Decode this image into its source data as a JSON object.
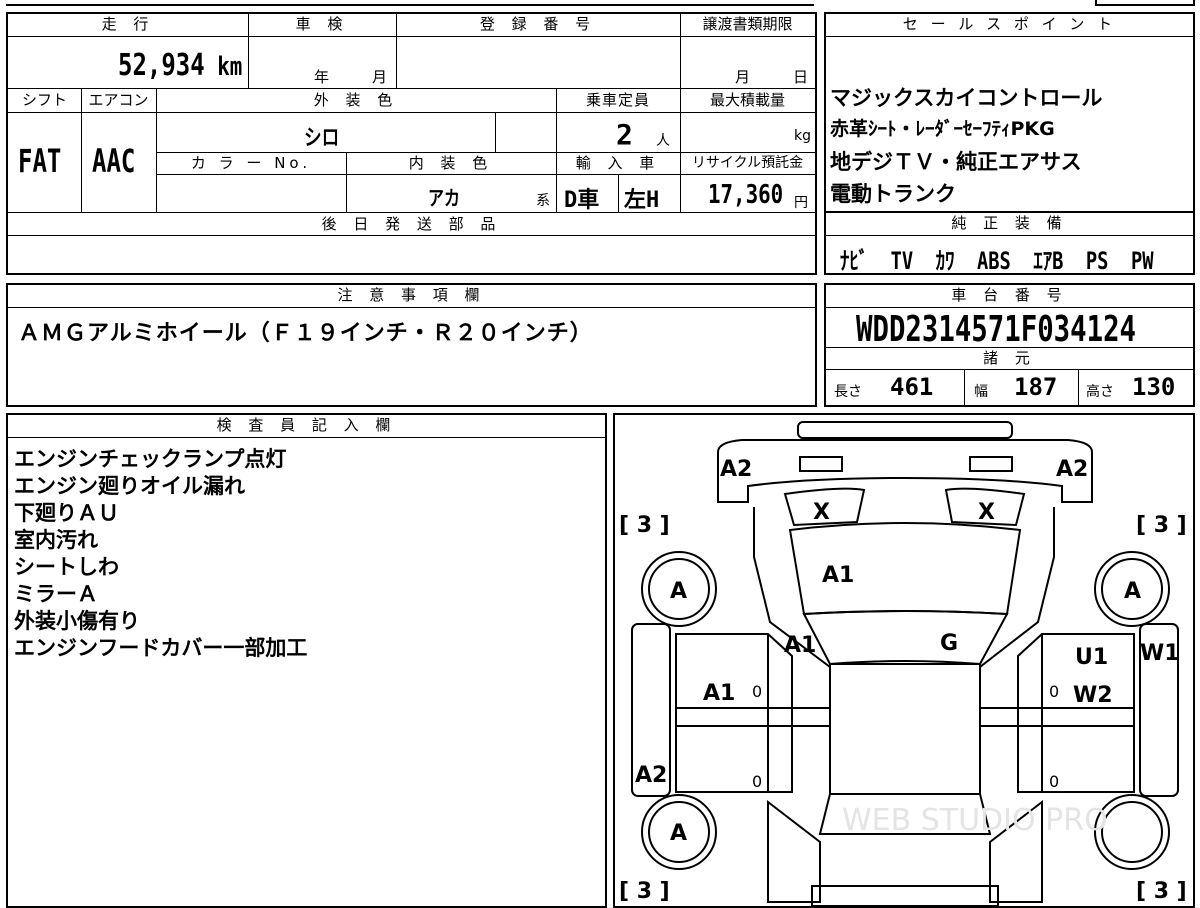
{
  "top": {
    "mileage_header": "走 行",
    "mileage_value": "52,934",
    "mileage_unit": "km",
    "shaken_header": "車 検",
    "shaken_year": "年",
    "shaken_month": "月",
    "registration_header": "登 録 番 号",
    "transfer_header": "譲渡書類期限",
    "transfer_month": "月",
    "transfer_day": "日"
  },
  "row2": {
    "shift_header": "シフト",
    "ac_header": "エアコン",
    "exterior_header": "外 装 色",
    "capacity_header": "乗車定員",
    "maxload_header": "最大積載量",
    "shift_value": "FAT",
    "ac_value": "AAC",
    "exterior_value": "シロ",
    "capacity_value": "2",
    "capacity_unit": "人",
    "maxload_unit": "kg",
    "colorno_header": "カ ラ ー No.",
    "interior_header": "内 装 色",
    "import_header": "輸 入 車",
    "recycle_header": "リサイクル預託金",
    "interior_value": "アカ",
    "interior_suffix": "系",
    "import_d": "D車",
    "import_h": "左H",
    "recycle_value": "17,360",
    "recycle_unit": "円"
  },
  "later_parts_header": "後 日 発 送 部 品",
  "sales": {
    "header": "セ ー ル ス ポ イ ン ト",
    "lines": [
      "マジックスカイコントロール",
      "赤革ｼｰﾄ・ﾚｰﾀﾞｰｾｰﾌﾃｨPKG",
      "地デジＴＶ・純正エアサス",
      "電動トランク"
    ]
  },
  "equipment": {
    "header": "純 正 装 備",
    "items": [
      "ﾅﾋﾞ",
      "TV",
      "ｶﾜ",
      "ABS",
      "ｴｱB",
      "PS",
      "PW"
    ]
  },
  "notes": {
    "header": "注 意 事 項 欄",
    "text": "ＡＭＧアルミホイール（Ｆ１９インチ・Ｒ２０インチ）"
  },
  "chassis": {
    "header": "車 台 番 号",
    "number": "WDD2314571F034124",
    "spec_header": "諸 元",
    "length_label": "長さ",
    "length_value": "461",
    "width_label": "幅",
    "width_value": "187",
    "height_label": "高さ",
    "height_value": "130"
  },
  "inspector": {
    "header": "検 査 員 記 入 欄",
    "lines": [
      "エンジンチェックランプ点灯",
      "エンジン廻りオイル漏れ",
      "下廻りＡＵ",
      "室内汚れ",
      "シートしわ",
      "ミラーＡ",
      "外装小傷有り",
      "エンジンフードカバー一部加工"
    ]
  },
  "diagram": {
    "front_left": "A2",
    "front_right": "A2",
    "windshield_left": "X",
    "windshield_right": "X",
    "hood": "A1",
    "left_fender": "A1",
    "roof_front": "G",
    "left_front_door": "A1",
    "right_front_u": "U1",
    "right_front_w": "W2",
    "right_mirror_side": "W1",
    "left_rear": "A2",
    "wheel_fl": "A",
    "wheel_fr": "A",
    "wheel_rl": "A",
    "tire_fl": "[ 3 ]",
    "tire_fr": "[ 3 ]",
    "tire_rl": "[ 3 ]",
    "tire_rr": "[ 3 ]",
    "door_fl_mark": "0",
    "door_fr_mark": "0",
    "door_rl_mark": "0",
    "door_rr_mark": "0",
    "watermark": "WEB STUDIO PRO"
  }
}
